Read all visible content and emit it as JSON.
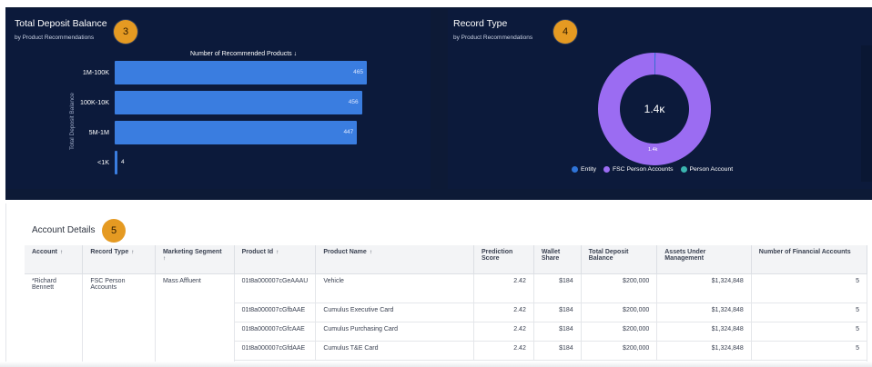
{
  "deposit_card": {
    "title": "Total Deposit Balance",
    "subtitle": "by Product Recommendations",
    "badge": "3",
    "x_axis_title": "Number of Recommended Products ↓",
    "y_axis_title": "Total Deposit Balance"
  },
  "record_card": {
    "title": "Record Type",
    "subtitle": "by Product Recommendations",
    "badge": "4",
    "center_label": "1.4κ",
    "slice_label": "1.4k",
    "legend": [
      {
        "label": "Entity",
        "color": "#2f74d8"
      },
      {
        "label": "FSC Person Accounts",
        "color": "#9b6cf2"
      },
      {
        "label": "Person Account",
        "color": "#3bb5b0"
      }
    ]
  },
  "chart_data": [
    {
      "type": "bar",
      "orientation": "horizontal",
      "title": "Total Deposit Balance",
      "subtitle": "by Product Recommendations",
      "xlabel": "Number of Recommended Products",
      "ylabel": "Total Deposit Balance",
      "categories": [
        "1M-100K",
        "100K-10K",
        "5M-1M",
        "<1K"
      ],
      "values": [
        465,
        456,
        447,
        4
      ],
      "xlim": [
        0,
        470
      ],
      "color": "#3a7de0"
    },
    {
      "type": "pie",
      "style": "donut",
      "title": "Record Type",
      "subtitle": "by Product Recommendations",
      "labels": [
        "Entity",
        "FSC Person Accounts",
        "Person Account"
      ],
      "values": [
        4,
        1372,
        0
      ],
      "colors": [
        "#2f74d8",
        "#9b6cf2",
        "#3bb5b0"
      ],
      "center_label": "1.4κ"
    }
  ],
  "details": {
    "title": "Account Details",
    "badge": "5",
    "columns": [
      {
        "label": "Account",
        "sort": "↑"
      },
      {
        "label": "Record Type",
        "sort": "↑"
      },
      {
        "label": "Marketing Segment",
        "sort": "↑"
      },
      {
        "label": "Product Id",
        "sort": "↑"
      },
      {
        "label": "Product Name",
        "sort": "↑"
      },
      {
        "label": "Prediction Score",
        "sort": ""
      },
      {
        "label": "Wallet Share",
        "sort": ""
      },
      {
        "label": "Total Deposit Balance",
        "sort": ""
      },
      {
        "label": "Assets Under Management",
        "sort": ""
      },
      {
        "label": "Number of Financial Accounts",
        "sort": ""
      }
    ],
    "group": {
      "account": "*Richard Bennett",
      "record_type": "FSC Person Accounts",
      "segment": "Mass Affluent"
    },
    "rows": [
      {
        "product_id": "01t8a000007cGeAAAU",
        "product_name": "Vehicle",
        "score": "2.42",
        "wallet": "$184",
        "deposit": "$200,000",
        "aum": "$1,324,848",
        "accounts": "5"
      },
      {
        "product_id": "01t8a000007cGfbAAE",
        "product_name": "Cumulus Executive Card",
        "score": "2.42",
        "wallet": "$184",
        "deposit": "$200,000",
        "aum": "$1,324,848",
        "accounts": "5"
      },
      {
        "product_id": "01t8a000007cGfcAAE",
        "product_name": "Cumulus Purchasing Card",
        "score": "2.42",
        "wallet": "$184",
        "deposit": "$200,000",
        "aum": "$1,324,848",
        "accounts": "5"
      },
      {
        "product_id": "01t8a000007cGfdAAE",
        "product_name": "Cumulus T&E Card",
        "score": "2.42",
        "wallet": "$184",
        "deposit": "$200,000",
        "aum": "$1,324,848",
        "accounts": "5"
      }
    ]
  }
}
